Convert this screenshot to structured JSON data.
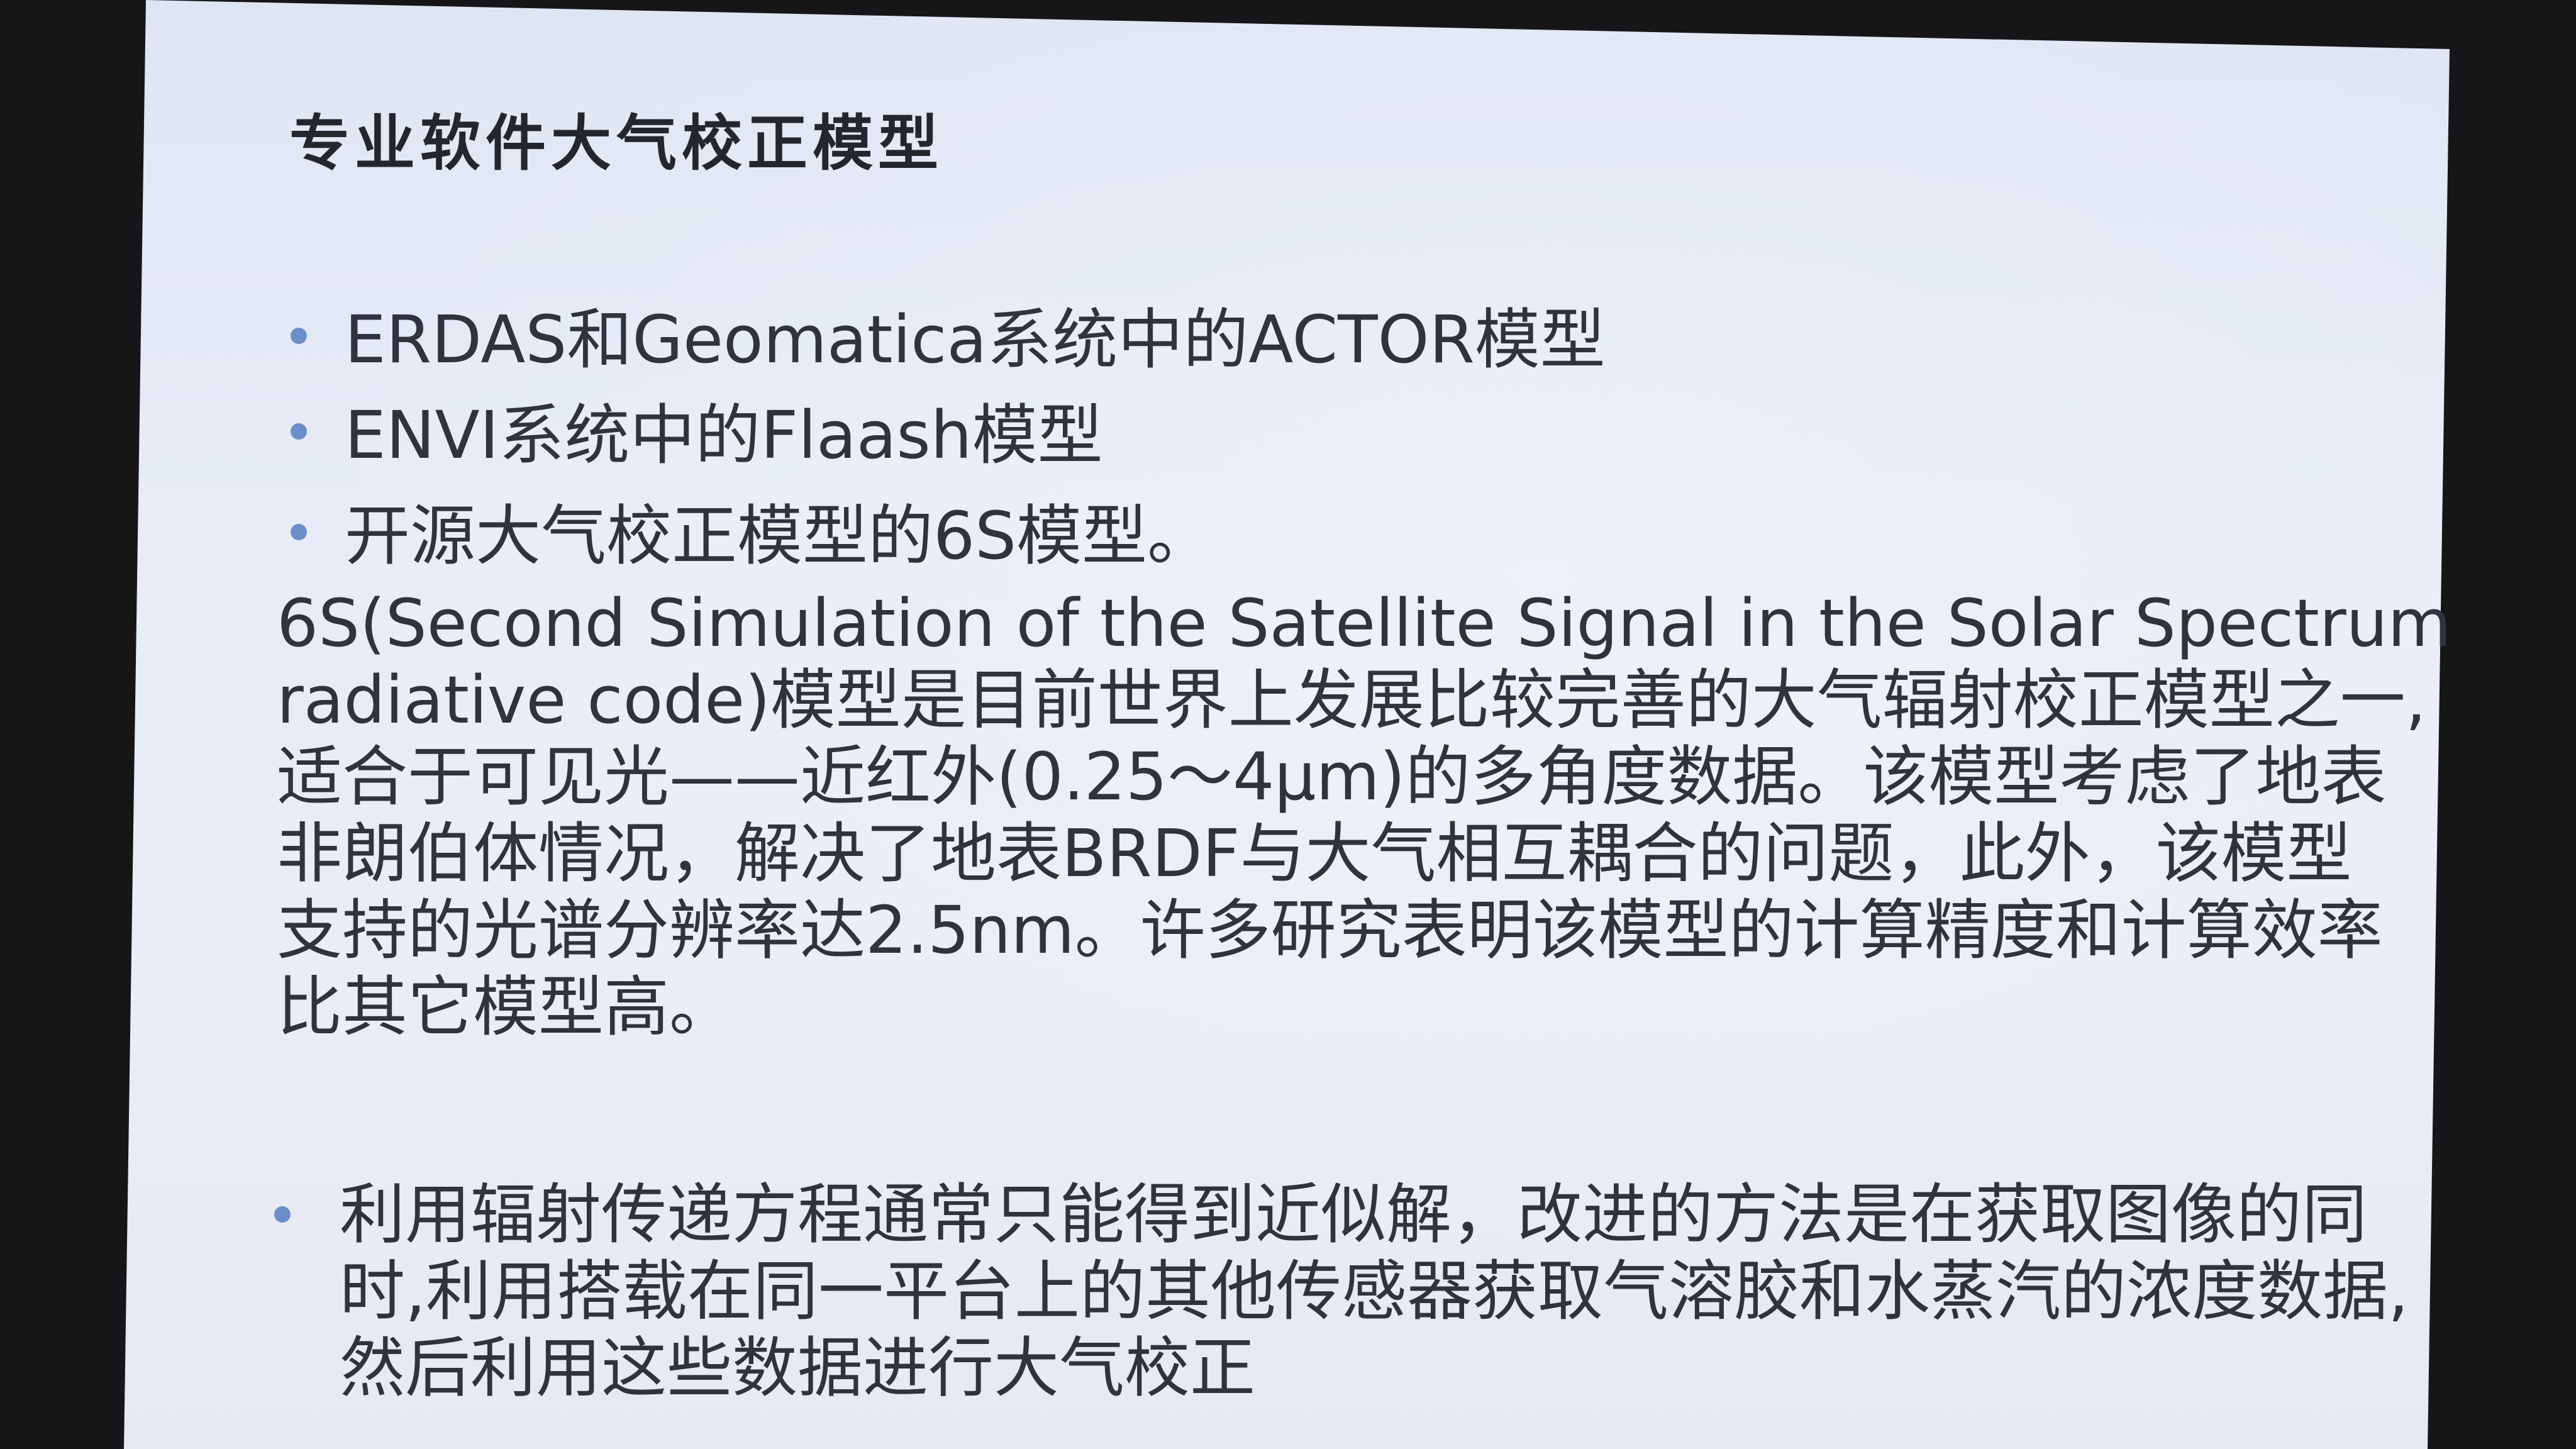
{
  "slide": {
    "title": "专业软件大气校正模型",
    "bullets": [
      "ERDAS和Geomatica系统中的ACTOR模型",
      "ENVI系统中的Flaash模型",
      "开源大气校正模型的6S模型。"
    ],
    "paragraph_lines": [
      "6S(Second Simulation of the Satellite Signal in the Solar Spectrum",
      "radiative code)模型是目前世界上发展比较完善的大气辐射校正模型之一,",
      "适合于可见光——近红外(0.25～4μm)的多角度数据。该模型考虑了地表",
      "非朗伯体情况，解决了地表BRDF与大气相互耦合的问题，此外，该模型",
      "支持的光谱分辨率达2.5nm。许多研究表明该模型的计算精度和计算效率",
      "比其它模型高。"
    ],
    "last_bullet_lines": [
      "利用辐射传递方程通常只能得到近似解，改进的方法是在获取图像的同",
      "时,利用搭载在同一平台上的其他传感器获取气溶胶和水蒸汽的浓度数据,",
      "然后利用这些数据进行大气校正"
    ],
    "colors": {
      "slide_background": "#e7ecf6",
      "text": "#2f333d",
      "bullet": "#6c8fc9",
      "surround": "#161618"
    }
  }
}
